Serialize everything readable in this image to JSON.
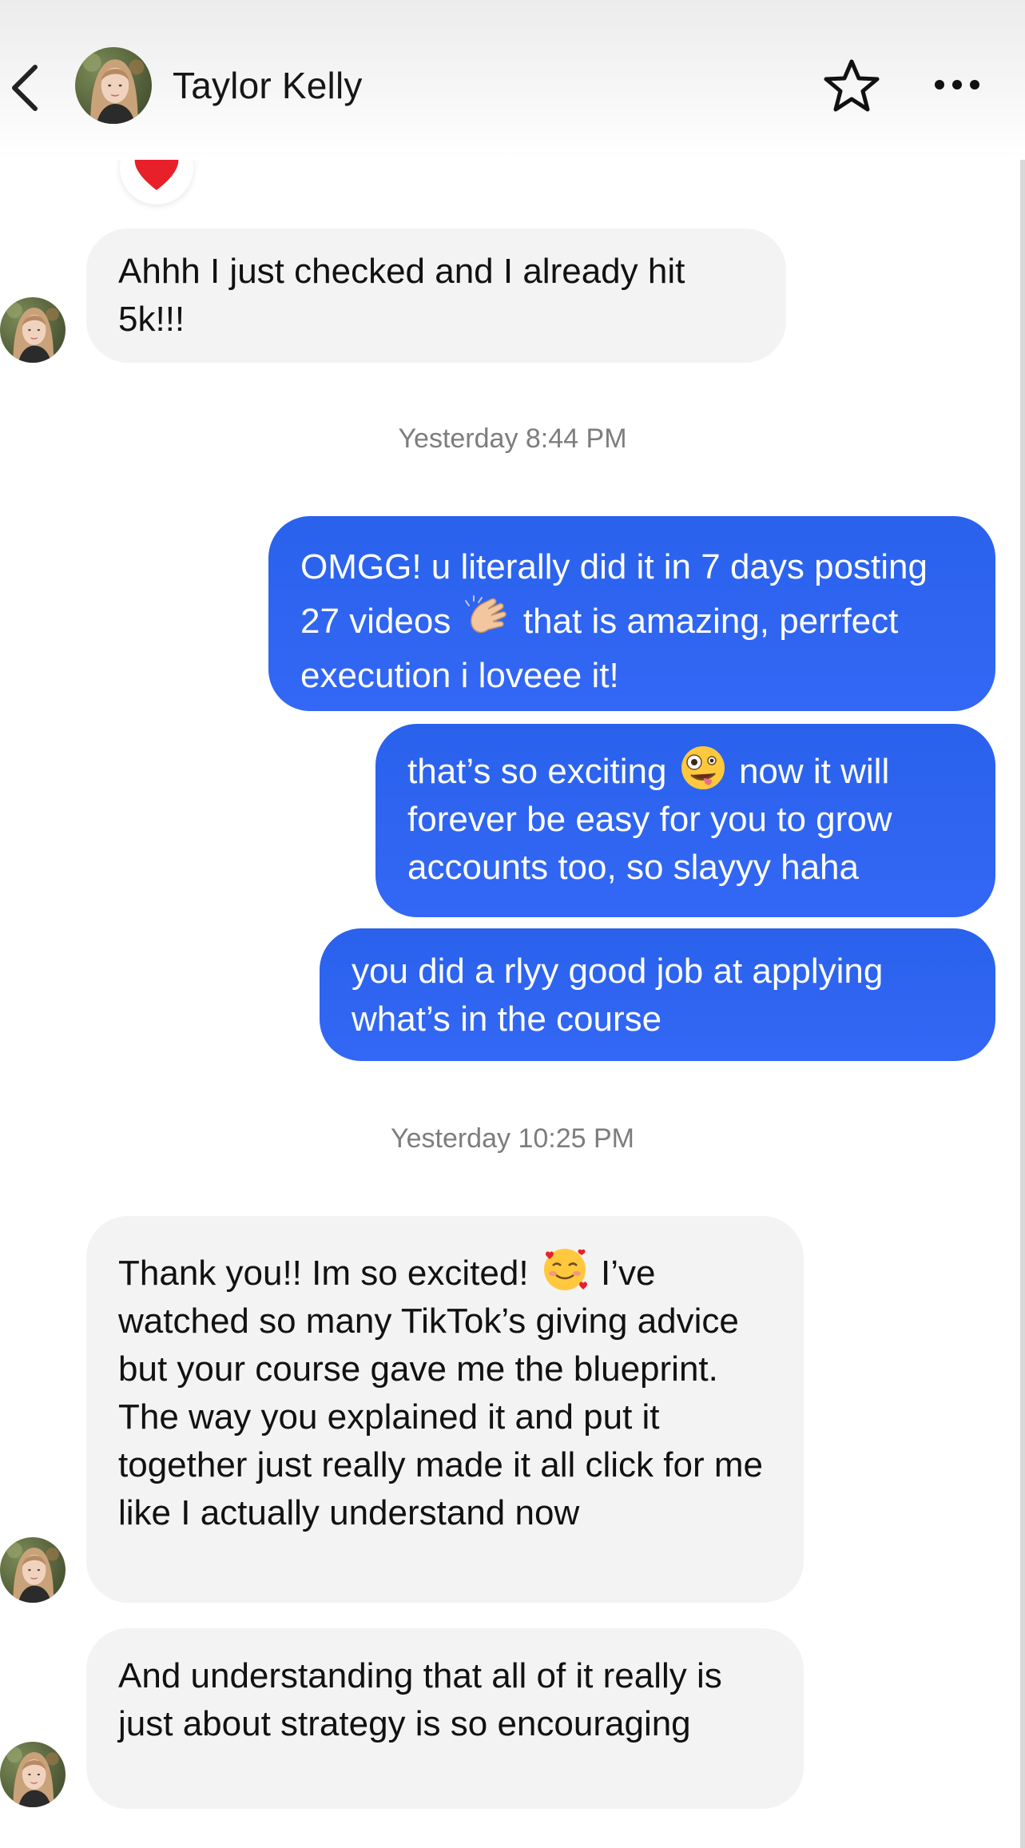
{
  "header": {
    "contact_name": "Taylor Kelly",
    "back_icon": "chevron-left-icon",
    "favorite_icon": "star-outline-icon",
    "more_icon": "more-horizontal-icon"
  },
  "reaction": {
    "emoji": "heart-emoji"
  },
  "messages": [
    {
      "sender": "contact",
      "text": "Ahhh I just checked and I already hit 5k!!!"
    },
    {
      "sender": "me",
      "text_before": "OMGG! u literally did it in 7 days posting 27 videos",
      "emoji": "clapping-hands-emoji",
      "text_after": "that is amazing, perrfect execution i loveee it!"
    },
    {
      "sender": "me",
      "text_before": "that’s so exciting",
      "emoji": "zany-face-emoji",
      "text_after": "now it will forever be easy for you to grow accounts too, so slayyy haha"
    },
    {
      "sender": "me",
      "text": "you did a rlyy good job at applying what’s in the course"
    },
    {
      "sender": "contact",
      "text_before": "Thank you!! Im so excited!",
      "emoji": "smiling-face-with-hearts-emoji",
      "text_after": "I’ve watched so many TikTok’s giving advice but your course gave me the blueprint. The way you explained it and put it together just really made it all click for me like I actually understand now"
    },
    {
      "sender": "contact",
      "text": "And understanding that all of it really is just about strategy is so encouraging"
    }
  ],
  "timestamps": [
    "Yesterday 8:44 PM",
    "Yesterday 10:25 PM"
  ],
  "colors": {
    "outgoing_bubble": "#2f64f2",
    "incoming_bubble": "#f3f3f3",
    "timestamp_text": "#7d7d7d"
  }
}
